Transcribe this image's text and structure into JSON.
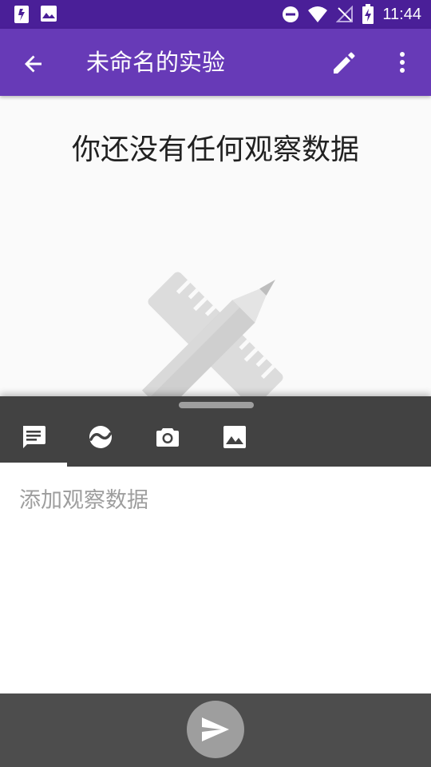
{
  "status_bar": {
    "time": "11:44",
    "icons": [
      "sim-icon",
      "image-notification-icon",
      "do-not-disturb-icon",
      "wifi-icon",
      "no-signal-icon",
      "battery-charging-icon"
    ]
  },
  "app_bar": {
    "title": "未命名的实验",
    "icons": [
      "back-arrow-icon",
      "edit-icon",
      "more-vert-icon"
    ]
  },
  "empty_state": {
    "title": "你还没有任何观察数据",
    "illustration": "ruler-pencil-icon"
  },
  "tabs": [
    {
      "name": "note",
      "icon": "note-icon",
      "selected": true
    },
    {
      "name": "sensor",
      "icon": "sensor-icon",
      "selected": false
    },
    {
      "name": "camera",
      "icon": "camera-icon",
      "selected": false
    },
    {
      "name": "gallery",
      "icon": "gallery-icon",
      "selected": false
    }
  ],
  "note_input": {
    "value": "",
    "placeholder": "添加观察数据"
  },
  "send_button": {
    "icon": "send-icon"
  },
  "colors": {
    "status_bar": "#4a1f98",
    "app_bar": "#673ab7",
    "sheet": "#424242",
    "bottom_bar": "#4d4d4d",
    "send_button": "#9e9e9e"
  }
}
